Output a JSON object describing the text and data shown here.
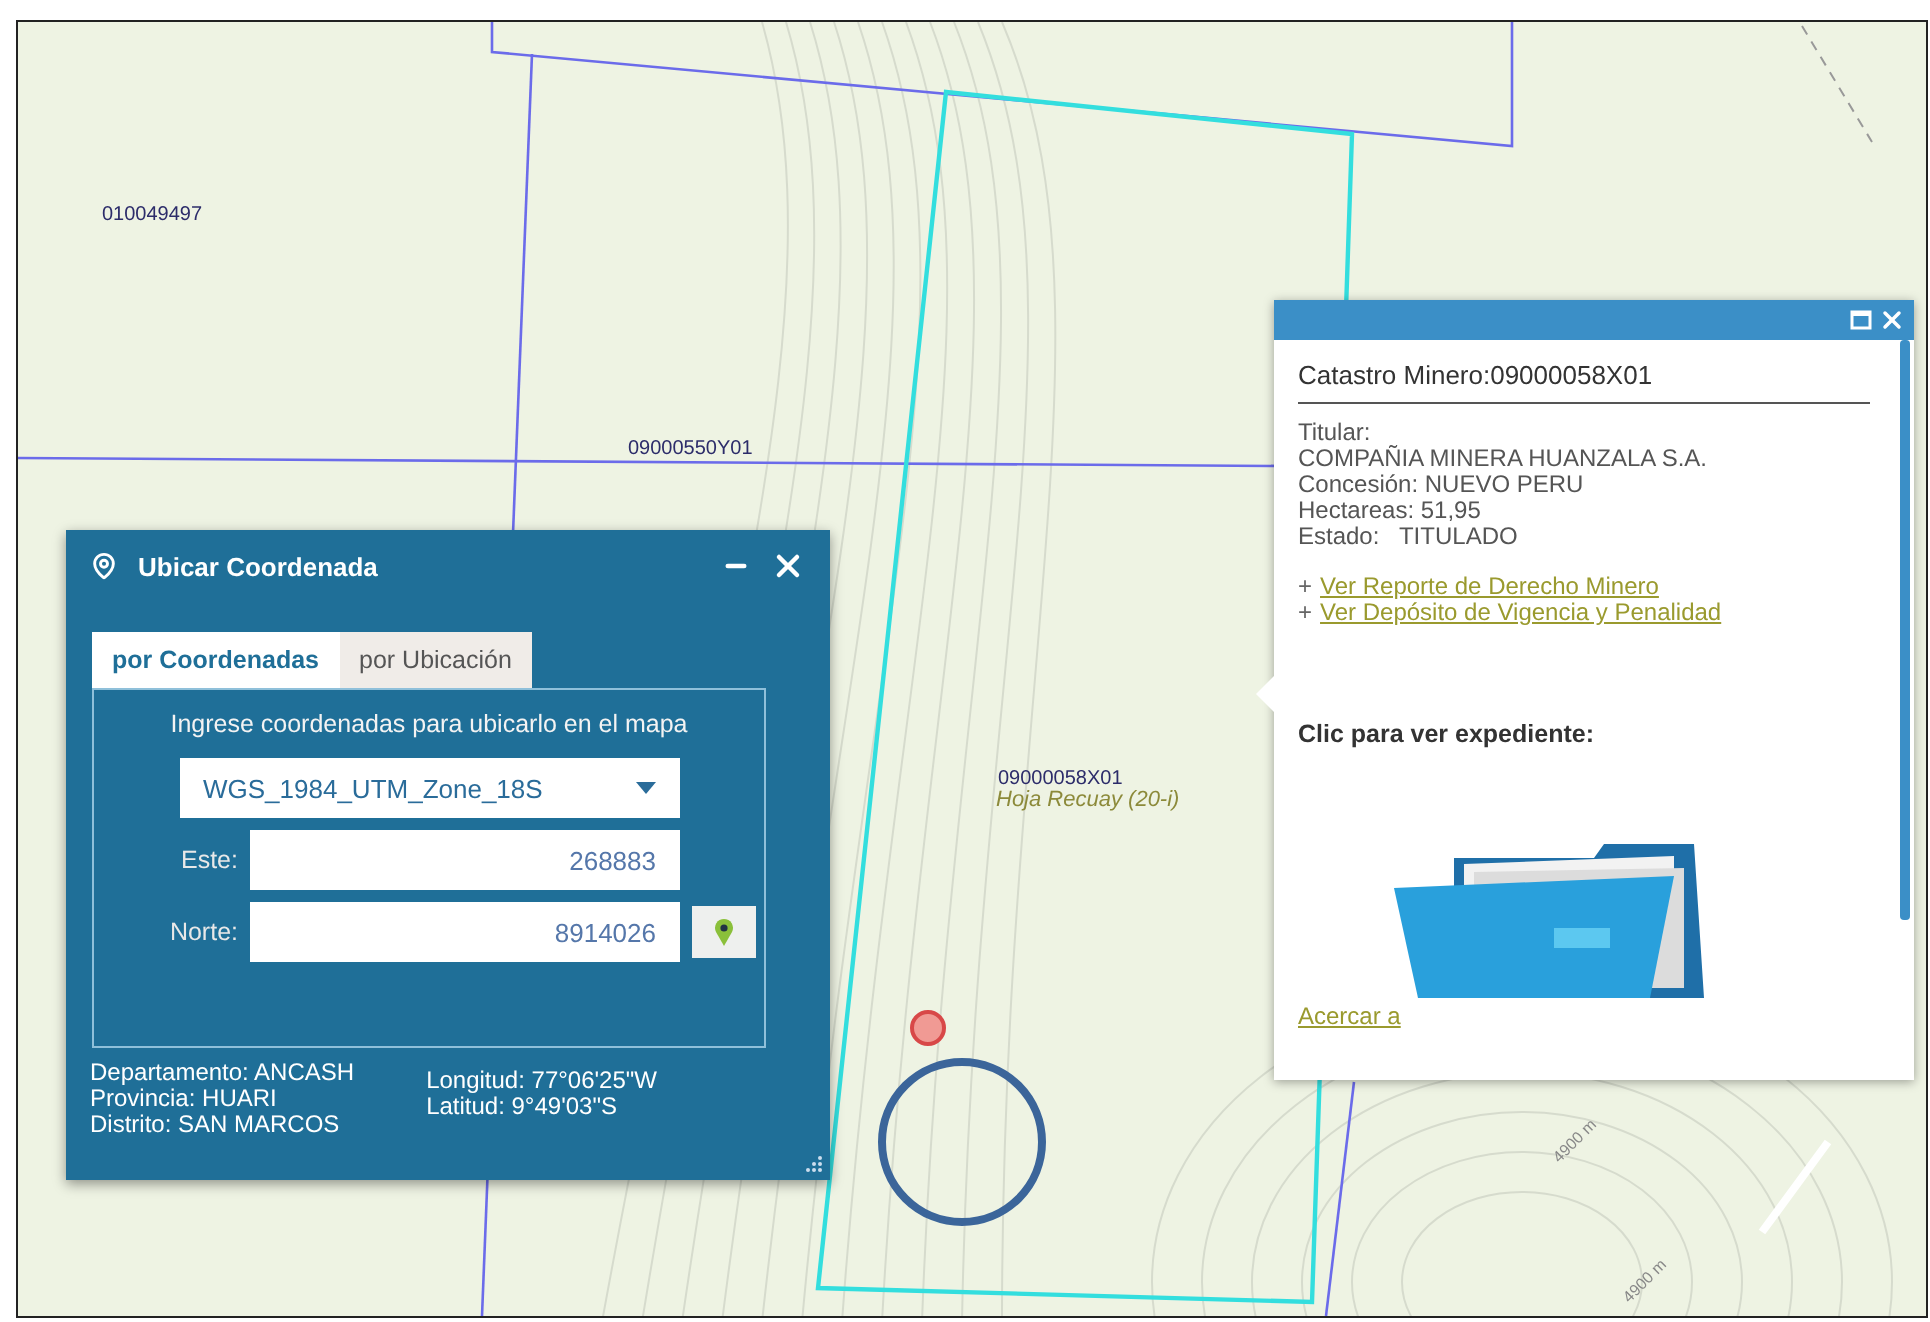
{
  "map": {
    "labels": [
      {
        "text": "010049497",
        "kind": "parcel"
      },
      {
        "text": "09000550Y01",
        "kind": "parcel"
      },
      {
        "text": "09000058X01",
        "kind": "parcel"
      },
      {
        "text": "Hoja Recuay (20-i)",
        "kind": "sheet"
      },
      {
        "text": "4900 m",
        "kind": "contour"
      },
      {
        "text": "4900 m",
        "kind": "contour"
      }
    ]
  },
  "locate_panel": {
    "title": "Ubicar Coordenada",
    "tabs": [
      {
        "label": "por Coordenadas",
        "selected": true
      },
      {
        "label": "por Ubicación",
        "selected": false
      }
    ],
    "instruction": "Ingrese coordenadas para ubicarlo en el mapa",
    "projection": "WGS_1984_UTM_Zone_18S",
    "fields": [
      {
        "label": "Este:",
        "value": "268883"
      },
      {
        "label": "Norte:",
        "value": "8914026"
      }
    ],
    "location": [
      "Departamento: ANCASH",
      "Provincia: HUARI",
      "Distrito: SAN MARCOS"
    ],
    "coordinates": [
      "Longitud: 77°06'25\"W",
      "Latitud: 9°49'03\"S"
    ]
  },
  "popup": {
    "title": "Catastro Minero:09000058X01",
    "details": [
      "Titular:",
      "COMPAÑIA MINERA HUANZALA S.A.",
      "Concesión: NUEVO PERU",
      "Hectareas: 51,95",
      "Estado:   TITULADO"
    ],
    "links": [
      {
        "bullet": "+",
        "text": "Ver Reporte de Derecho Minero"
      },
      {
        "bullet": "+",
        "text": "Ver Depósito de Vigencia y Penalidad"
      }
    ],
    "prompt": "Clic para ver expediente:",
    "zoom_link": "Acercar a"
  }
}
